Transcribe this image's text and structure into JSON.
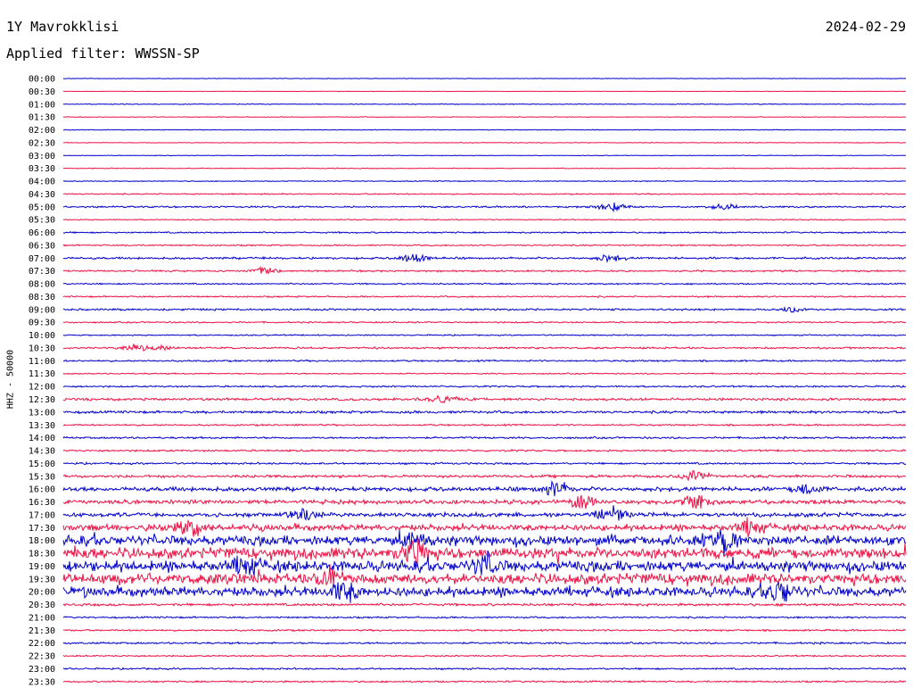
{
  "header": {
    "station": "1Y Mavrokklisi",
    "date": "2024-02-29",
    "filter_label": "Applied filter: WWSSN-SP"
  },
  "chart_data": {
    "type": "line",
    "title": "1Y Mavrokklisi",
    "ylabel": "HHZ - 50000",
    "row_labels": [
      "00:00",
      "00:30",
      "01:00",
      "01:30",
      "02:00",
      "02:30",
      "03:00",
      "03:30",
      "04:00",
      "04:30",
      "05:00",
      "05:30",
      "06:00",
      "06:30",
      "07:00",
      "07:30",
      "08:00",
      "08:30",
      "09:00",
      "09:30",
      "10:00",
      "10:30",
      "11:00",
      "11:30",
      "12:00",
      "12:30",
      "13:00",
      "13:30",
      "14:00",
      "14:30",
      "15:00",
      "15:30",
      "16:00",
      "16:30",
      "17:00",
      "17:30",
      "18:00",
      "18:30",
      "19:00",
      "19:30",
      "20:00",
      "20:30",
      "21:00",
      "21:30",
      "22:00",
      "22:30",
      "23:00",
      "23:30"
    ],
    "row_minutes": 30,
    "trace_colors": [
      "#0000cc",
      "#ee1144"
    ],
    "activity_level": [
      0.2,
      0.2,
      0.4,
      0.3,
      0.3,
      0.3,
      0.3,
      0.4,
      0.4,
      0.6,
      0.8,
      0.5,
      0.7,
      0.7,
      1.0,
      0.8,
      0.7,
      0.7,
      0.9,
      0.7,
      0.6,
      0.9,
      0.8,
      0.6,
      0.8,
      1.2,
      1.2,
      0.8,
      0.9,
      0.9,
      0.9,
      1.3,
      2.0,
      2.0,
      2.0,
      3.0,
      4.5,
      5.0,
      5.0,
      5.0,
      4.5,
      1.2,
      0.8,
      0.8,
      0.9,
      0.7,
      0.8,
      0.8
    ],
    "events": [
      {
        "row": 10,
        "minute": 19.5,
        "amplitude": 5
      },
      {
        "row": 10,
        "minute": 23.5,
        "amplitude": 4
      },
      {
        "row": 14,
        "minute": 12.5,
        "amplitude": 6
      },
      {
        "row": 14,
        "minute": 19.5,
        "amplitude": 5
      },
      {
        "row": 15,
        "minute": 7.2,
        "amplitude": 5
      },
      {
        "row": 18,
        "minute": 26,
        "amplitude": 4
      },
      {
        "row": 21,
        "minute": 2.5,
        "amplitude": 4
      },
      {
        "row": 21,
        "minute": 3.5,
        "amplitude": 3
      },
      {
        "row": 25,
        "minute": 13.5,
        "amplitude": 6
      },
      {
        "row": 31,
        "minute": 22.5,
        "amplitude": 8
      },
      {
        "row": 32,
        "minute": 17.5,
        "amplitude": 10
      },
      {
        "row": 32,
        "minute": 26.5,
        "amplitude": 7
      },
      {
        "row": 33,
        "minute": 18.5,
        "amplitude": 8
      },
      {
        "row": 33,
        "minute": 22.5,
        "amplitude": 9
      },
      {
        "row": 34,
        "minute": 8.5,
        "amplitude": 9
      },
      {
        "row": 34,
        "minute": 19.5,
        "amplitude": 11
      },
      {
        "row": 35,
        "minute": 4.5,
        "amplitude": 9
      },
      {
        "row": 35,
        "minute": 24.5,
        "amplitude": 10
      },
      {
        "row": 36,
        "minute": 12.5,
        "amplitude": 10
      },
      {
        "row": 36,
        "minute": 23.5,
        "amplitude": 14
      },
      {
        "row": 37,
        "minute": 12.5,
        "amplitude": 17
      },
      {
        "row": 38,
        "minute": 6.5,
        "amplitude": 11
      },
      {
        "row": 38,
        "minute": 15,
        "amplitude": 12
      },
      {
        "row": 39,
        "minute": 9.5,
        "amplitude": 11
      },
      {
        "row": 40,
        "minute": 10,
        "amplitude": 12
      },
      {
        "row": 40,
        "minute": 25.5,
        "amplitude": 13
      }
    ]
  }
}
